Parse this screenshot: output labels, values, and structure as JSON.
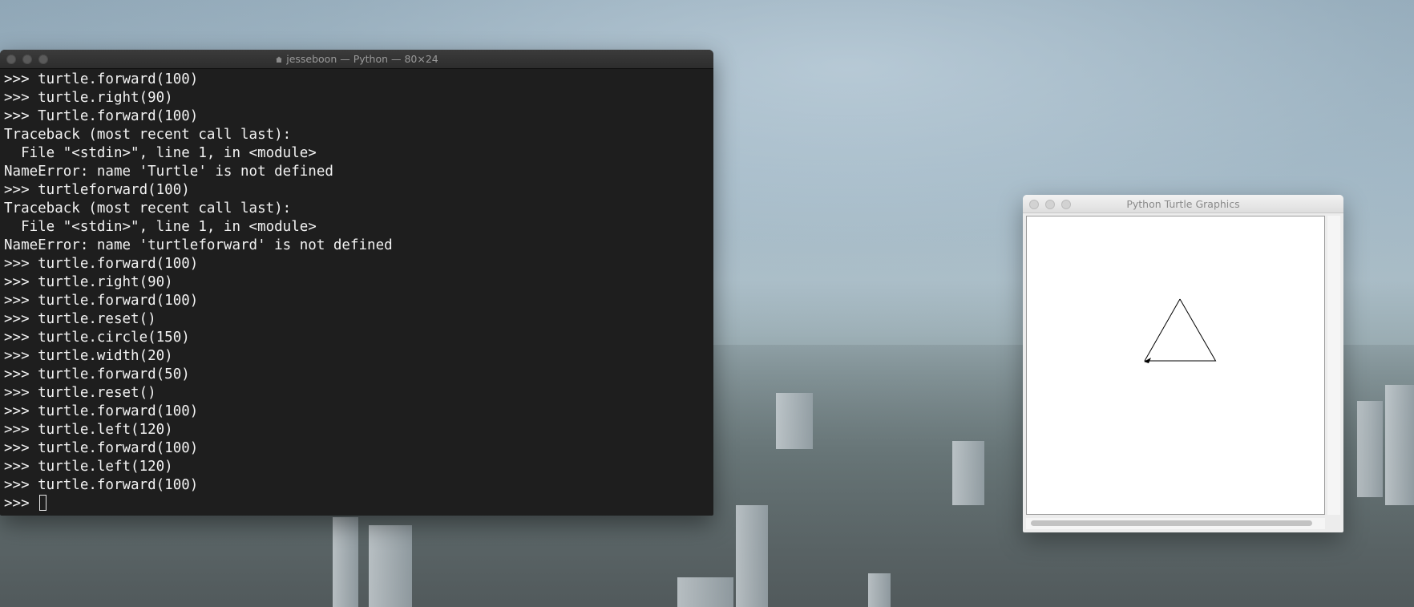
{
  "terminal": {
    "title": "jesseboon — Python — 80×24",
    "lines": [
      {
        "text": ">>> turtle.forward(100)",
        "mark": true
      },
      {
        "text": ">>> turtle.right(90)",
        "mark": true
      },
      {
        "text": ">>> Turtle.forward(100)",
        "mark": true
      },
      {
        "text": "Traceback (most recent call last):",
        "mark": false
      },
      {
        "text": "  File \"<stdin>\", line 1, in <module>",
        "mark": false
      },
      {
        "text": "NameError: name 'Turtle' is not defined",
        "mark": false
      },
      {
        "text": ">>> turtleforward(100)",
        "mark": true
      },
      {
        "text": "Traceback (most recent call last):",
        "mark": false
      },
      {
        "text": "  File \"<stdin>\", line 1, in <module>",
        "mark": false
      },
      {
        "text": "NameError: name 'turtleforward' is not defined",
        "mark": false
      },
      {
        "text": ">>> turtle.forward(100)",
        "mark": true
      },
      {
        "text": ">>> turtle.right(90)",
        "mark": true
      },
      {
        "text": ">>> turtle.forward(100)",
        "mark": true
      },
      {
        "text": ">>> turtle.reset()",
        "mark": true
      },
      {
        "text": ">>> turtle.circle(150)",
        "mark": true
      },
      {
        "text": ">>> turtle.width(20)",
        "mark": true
      },
      {
        "text": ">>> turtle.forward(50)",
        "mark": true
      },
      {
        "text": ">>> turtle.reset()",
        "mark": true
      },
      {
        "text": ">>> turtle.forward(100)",
        "mark": true
      },
      {
        "text": ">>> turtle.left(120)",
        "mark": true
      },
      {
        "text": ">>> turtle.forward(100)",
        "mark": true
      },
      {
        "text": ">>> turtle.left(120)",
        "mark": true
      },
      {
        "text": ">>> turtle.forward(100)",
        "mark": true
      }
    ],
    "prompt": ">>> "
  },
  "turtle_window": {
    "title": "Python Turtle Graphics"
  },
  "colors": {
    "terminal_bg": "#1e1e1e",
    "terminal_text": "#f2f2f2",
    "canvas_bg": "#ffffff",
    "pen": "#000000"
  }
}
